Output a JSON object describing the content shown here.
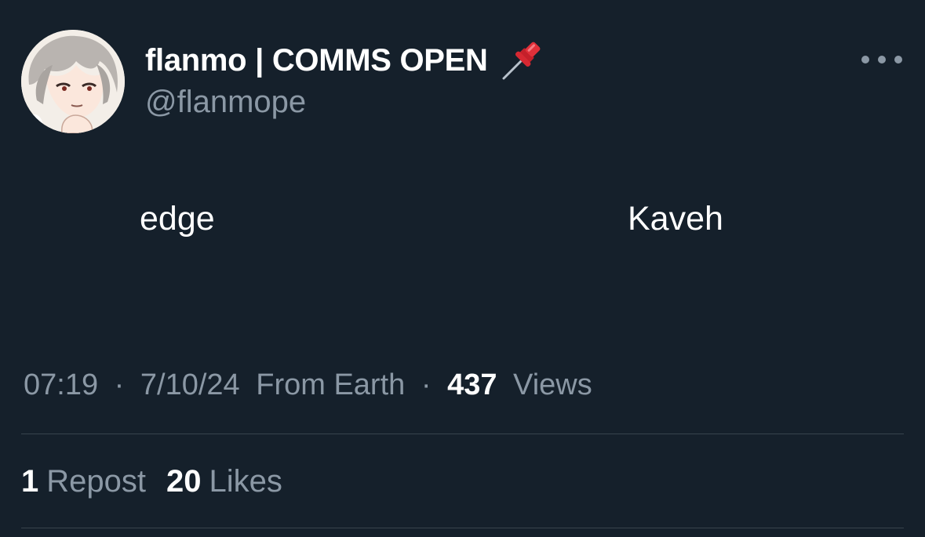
{
  "user": {
    "display_name": "flanmo | COMMS OPEN",
    "handle": "@flanmope",
    "badge_icon": "pushpin-icon"
  },
  "tweet": {
    "words": [
      "edge",
      "Kaveh"
    ]
  },
  "meta": {
    "time": "07:19",
    "separator_1": "·",
    "date": "7/10/24",
    "source": "From Earth",
    "separator_2": "·",
    "views_count": "437",
    "views_label": "Views"
  },
  "stats": {
    "reposts_count": "1",
    "reposts_label": "Repost",
    "likes_count": "20",
    "likes_label": "Likes"
  },
  "colors": {
    "background": "#15202b",
    "secondary_text": "#8b98a5",
    "divider": "#38444d"
  }
}
